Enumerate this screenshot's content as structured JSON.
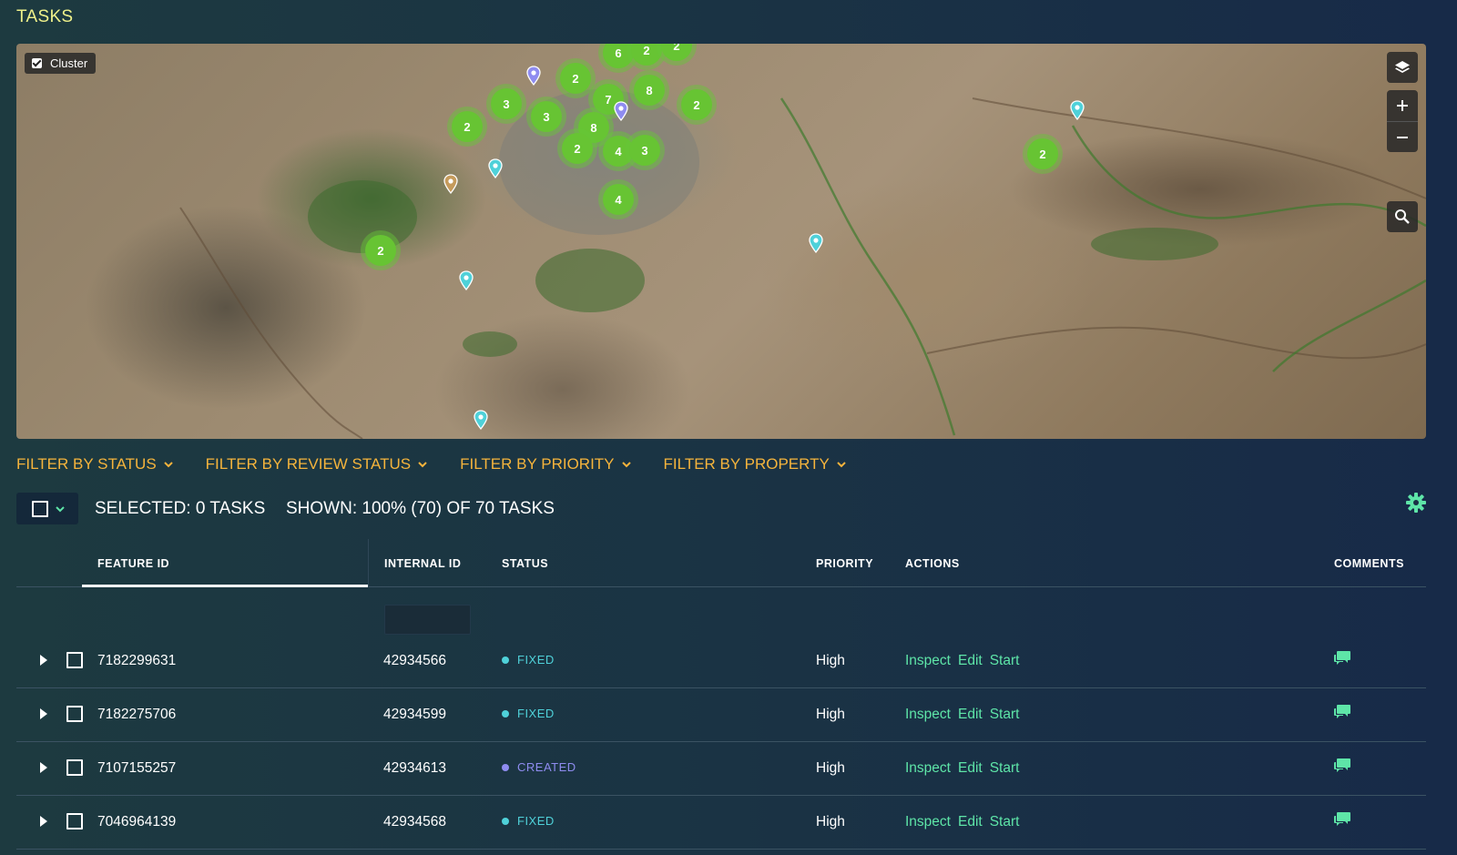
{
  "page": {
    "title": "TASKS"
  },
  "map": {
    "cluster_label": "Cluster",
    "cluster_checked": true,
    "controls": [
      "layers-icon",
      "zoom-in-icon",
      "zoom-out-icon",
      "search-icon"
    ],
    "clusters": [
      "6",
      "2",
      "2",
      "2",
      "3",
      "3",
      "7",
      "8",
      "2",
      "2",
      "8",
      "2",
      "4",
      "3",
      "4",
      "2",
      "2"
    ]
  },
  "filters": [
    {
      "label": "FILTER BY STATUS"
    },
    {
      "label": "FILTER BY REVIEW STATUS"
    },
    {
      "label": "FILTER BY PRIORITY"
    },
    {
      "label": "FILTER BY PROPERTY"
    }
  ],
  "selection": {
    "selected_text": "SELECTED: 0 TASKS",
    "shown_text": "SHOWN: 100% (70) OF 70 TASKS"
  },
  "table": {
    "headers": {
      "feature_id": "FEATURE ID",
      "internal_id": "INTERNAL ID",
      "status": "STATUS",
      "priority": "PRIORITY",
      "actions": "ACTIONS",
      "comments": "COMMENTS"
    },
    "actions": {
      "inspect": "Inspect",
      "edit": "Edit",
      "start": "Start"
    },
    "rows": [
      {
        "feature_id": "7182299631",
        "internal_id": "42934566",
        "status": "FIXED",
        "priority": "High"
      },
      {
        "feature_id": "7182275706",
        "internal_id": "42934599",
        "status": "FIXED",
        "priority": "High"
      },
      {
        "feature_id": "7107155257",
        "internal_id": "42934613",
        "status": "CREATED",
        "priority": "High"
      },
      {
        "feature_id": "7046964139",
        "internal_id": "42934568",
        "status": "FIXED",
        "priority": "High"
      }
    ]
  },
  "colors": {
    "title": "#eef08a",
    "filter": "#f5b43c",
    "action_link": "#5ee5a8",
    "status_fixed": "#4fd1d9",
    "status_created": "#8f8cf0",
    "cluster": "#67c433"
  }
}
